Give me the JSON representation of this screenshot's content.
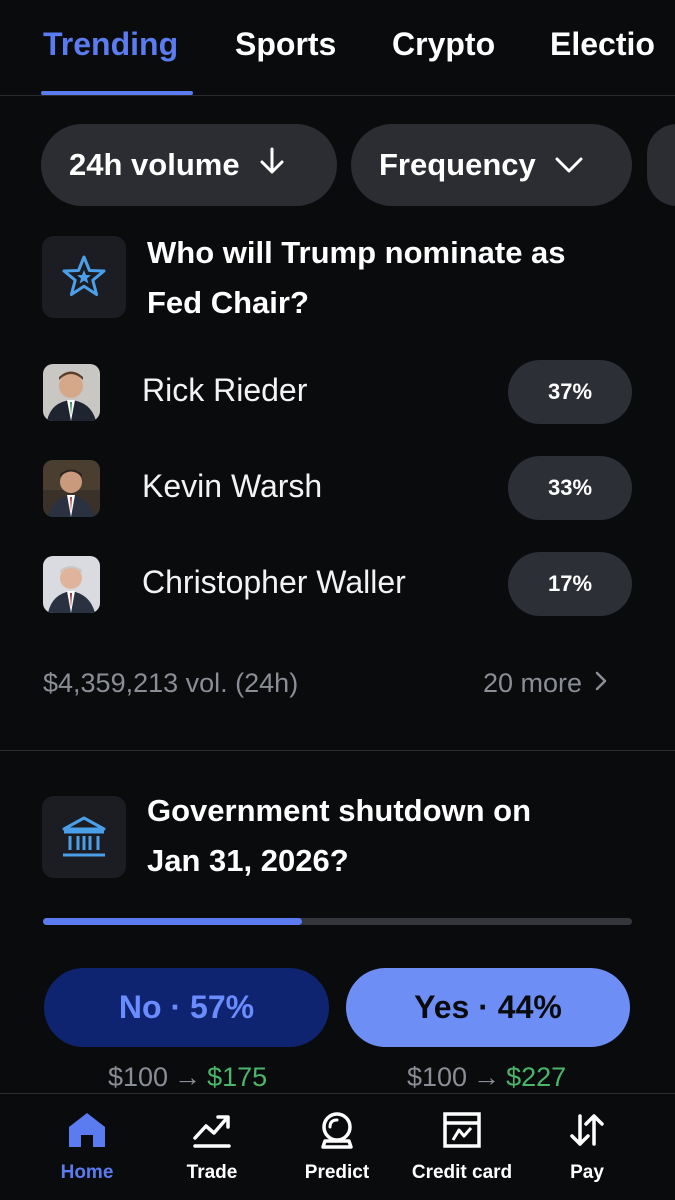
{
  "tabs": [
    {
      "label": "Trending",
      "active": true
    },
    {
      "label": "Sports",
      "active": false
    },
    {
      "label": "Crypto",
      "active": false
    },
    {
      "label": "Electio",
      "active": false
    }
  ],
  "filters": {
    "volume_label": "24h volume",
    "frequency_label": "Frequency"
  },
  "market1": {
    "icon": "star-icon",
    "title_line1": "Who will Trump nominate as",
    "title_line2": "Fed Chair?",
    "outcomes": [
      {
        "name": "Rick Rieder",
        "pct": "37%",
        "avatar": "avatar-rick-rieder"
      },
      {
        "name": "Kevin Warsh",
        "pct": "33%",
        "avatar": "avatar-kevin-warsh"
      },
      {
        "name": "Christopher Waller",
        "pct": "17%",
        "avatar": "avatar-christopher-waller"
      }
    ],
    "volume": "$4,359,213 vol. (24h)",
    "more": "20 more"
  },
  "market2": {
    "icon": "bank-icon",
    "title_line1": "Government shutdown on",
    "title_line2": "Jan 31, 2026?",
    "progress_fraction": 0.44,
    "no_label": "No · 57%",
    "yes_label": "Yes · 44%",
    "no_payout": {
      "stake": "$100",
      "arrow": "→",
      "win": "$175"
    },
    "yes_payout": {
      "stake": "$100",
      "arrow": "→",
      "win": "$227"
    }
  },
  "nav": [
    {
      "label": "Home",
      "icon": "home-icon",
      "active": true
    },
    {
      "label": "Trade",
      "icon": "trade-chart-icon",
      "active": false
    },
    {
      "label": "Predict",
      "icon": "crystal-ball-icon",
      "active": false
    },
    {
      "label": "Credit card",
      "icon": "credit-card-icon",
      "active": false
    },
    {
      "label": "Pay",
      "icon": "transfer-arrows-icon",
      "active": false
    }
  ],
  "colors": {
    "accent": "#5b7cf0",
    "background": "#0a0b0d",
    "pill": "#2c2f35",
    "positive": "#4bb66a",
    "no_button": "#0f2470",
    "yes_button": "#6d8ff5"
  }
}
